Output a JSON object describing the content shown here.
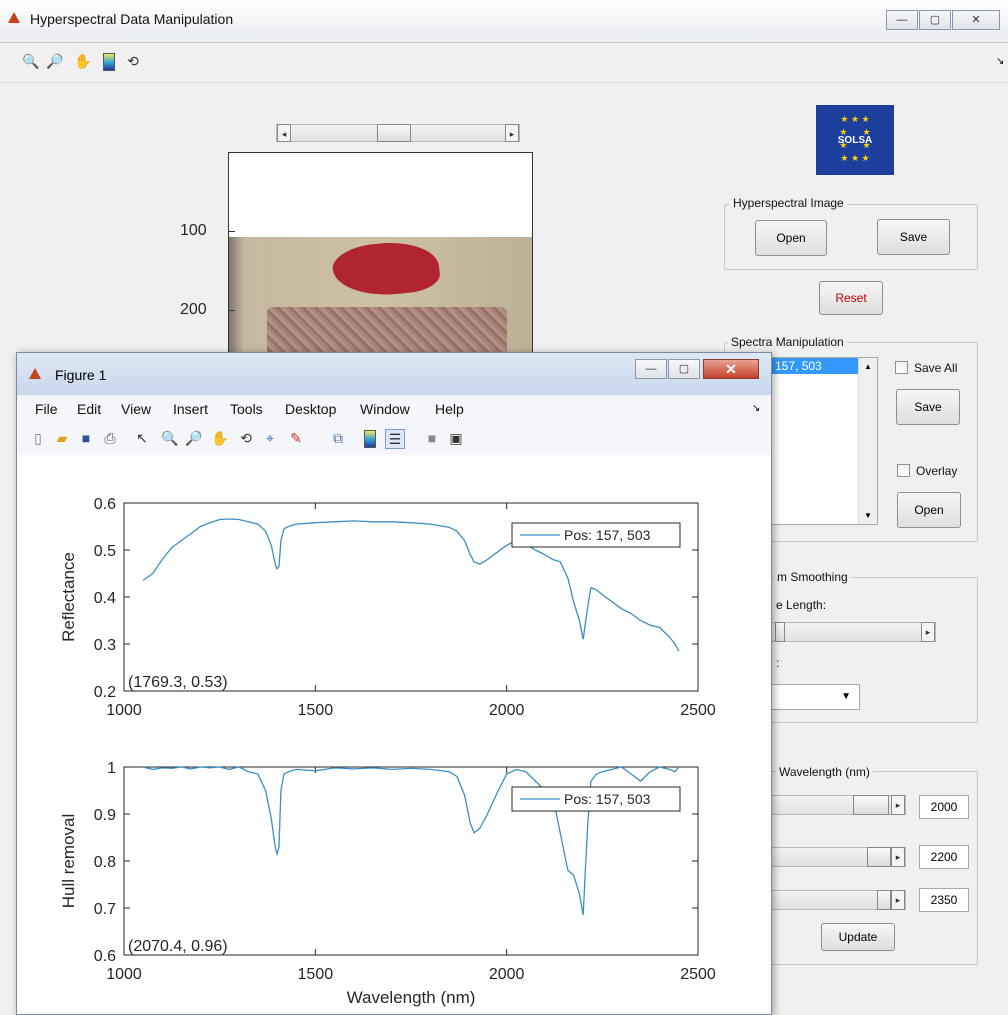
{
  "main_window": {
    "title": "Hyperspectral Data Manipulation",
    "controls": {
      "minimize": "—",
      "maximize": "▢",
      "close": "✕"
    },
    "toolbar_icons": [
      "zoom-in-icon",
      "zoom-out-icon",
      "pan-icon",
      "colorbar-icon",
      "rotate-icon"
    ],
    "image_axis_ticks": [
      "100",
      "200"
    ],
    "logo_text": "SOLSA",
    "hyperspectral_image": {
      "label": "Hyperspectral Image",
      "open": "Open",
      "save": "Save"
    },
    "reset": "Reset",
    "spectra_manipulation": {
      "label": "Spectra Manipulation",
      "list_item": "157, 503",
      "save_all": "Save All",
      "save": "Save",
      "overlay": "Overlay",
      "open": "Open"
    },
    "smoothing": {
      "label": "m Smoothing",
      "sublabel": "e Length:",
      "sublabel2": ":"
    },
    "wavelength": {
      "label": "Wavelength (nm)",
      "values": [
        "2000",
        "2200",
        "2350"
      ],
      "update": "Update"
    }
  },
  "figure_window": {
    "title": "Figure 1",
    "menu": [
      "File",
      "Edit",
      "View",
      "Insert",
      "Tools",
      "Desktop",
      "Window",
      "Help"
    ],
    "toolbar_icons": [
      "new-icon",
      "open-icon",
      "save-icon",
      "print-icon",
      "pointer-icon",
      "zoom-in-icon",
      "zoom-out-icon",
      "pan-icon",
      "rotate-icon",
      "datacursor-icon",
      "brush-icon",
      "link-icon",
      "colorbar-icon",
      "legend-icon",
      "hide-icon",
      "layout-icon"
    ]
  },
  "chart_data": [
    {
      "type": "line",
      "ylabel": "Reflectance",
      "xlabel": "",
      "xlim": [
        1000,
        2500
      ],
      "ylim": [
        0.2,
        0.6
      ],
      "xticks": [
        "1000",
        "1500",
        "2000",
        "2500"
      ],
      "yticks": [
        "0.2",
        "0.3",
        "0.4",
        "0.5",
        "0.6"
      ],
      "legend": "Pos: 157, 503",
      "legend_position": "top-right",
      "annotation": "(1769.3, 0.53)",
      "color": "#3b8fc6",
      "series": [
        {
          "name": "Pos: 157, 503",
          "x": [
            1050,
            1075,
            1100,
            1125,
            1150,
            1175,
            1200,
            1225,
            1250,
            1275,
            1300,
            1325,
            1350,
            1370,
            1385,
            1395,
            1400,
            1405,
            1410,
            1418,
            1430,
            1450,
            1500,
            1550,
            1600,
            1650,
            1700,
            1750,
            1800,
            1850,
            1870,
            1890,
            1905,
            1915,
            1930,
            1950,
            1975,
            2000,
            2025,
            2050,
            2075,
            2100,
            2120,
            2140,
            2160,
            2175,
            2190,
            2200,
            2205,
            2212,
            2220,
            2235,
            2250,
            2275,
            2300,
            2325,
            2350,
            2375,
            2400,
            2425,
            2440,
            2450
          ],
          "y": [
            0.435,
            0.45,
            0.48,
            0.505,
            0.52,
            0.535,
            0.55,
            0.558,
            0.565,
            0.566,
            0.565,
            0.56,
            0.555,
            0.54,
            0.51,
            0.47,
            0.46,
            0.465,
            0.52,
            0.545,
            0.55,
            0.555,
            0.558,
            0.56,
            0.562,
            0.56,
            0.56,
            0.558,
            0.555,
            0.548,
            0.54,
            0.52,
            0.49,
            0.475,
            0.47,
            0.48,
            0.495,
            0.51,
            0.52,
            0.512,
            0.5,
            0.49,
            0.48,
            0.475,
            0.44,
            0.39,
            0.35,
            0.31,
            0.34,
            0.38,
            0.42,
            0.415,
            0.405,
            0.39,
            0.375,
            0.365,
            0.35,
            0.34,
            0.335,
            0.315,
            0.3,
            0.285
          ]
        }
      ]
    },
    {
      "type": "line",
      "ylabel": "Hull removal",
      "xlabel": "Wavelength (nm)",
      "xlim": [
        1000,
        2500
      ],
      "ylim": [
        0.6,
        1
      ],
      "xticks": [
        "1000",
        "1500",
        "2000",
        "2500"
      ],
      "yticks": [
        "0.6",
        "0.7",
        "0.8",
        "0.9",
        "1"
      ],
      "legend": "Pos: 157, 503",
      "legend_position": "top-right",
      "annotation": "(2070.4, 0.96)",
      "color": "#3b8fc6",
      "series": [
        {
          "name": "Pos: 157, 503",
          "x": [
            1050,
            1075,
            1100,
            1125,
            1150,
            1175,
            1200,
            1225,
            1250,
            1275,
            1300,
            1325,
            1350,
            1370,
            1385,
            1395,
            1400,
            1405,
            1410,
            1418,
            1430,
            1450,
            1500,
            1550,
            1600,
            1650,
            1700,
            1750,
            1800,
            1850,
            1870,
            1890,
            1905,
            1915,
            1930,
            1950,
            1975,
            2000,
            2025,
            2050,
            2075,
            2100,
            2120,
            2140,
            2160,
            2175,
            2190,
            2200,
            2205,
            2212,
            2220,
            2235,
            2250,
            2275,
            2300,
            2325,
            2350,
            2375,
            2400,
            2425,
            2440,
            2450
          ],
          "y": [
            1,
            0.995,
            0.998,
            0.997,
            1,
            0.996,
            1,
            0.998,
            1,
            0.995,
            1,
            0.99,
            0.985,
            0.95,
            0.89,
            0.83,
            0.815,
            0.83,
            0.95,
            0.985,
            0.99,
            0.995,
            0.992,
            0.998,
            0.996,
            0.998,
            0.995,
            0.997,
            0.995,
            0.99,
            0.98,
            0.94,
            0.88,
            0.86,
            0.87,
            0.9,
            0.945,
            0.985,
            0.995,
            0.99,
            0.97,
            0.95,
            0.94,
            0.86,
            0.78,
            0.77,
            0.73,
            0.685,
            0.77,
            0.88,
            0.97,
            0.985,
            0.99,
            0.995,
            1,
            0.985,
            0.97,
            0.99,
            1,
            0.995,
            0.99,
            1
          ]
        }
      ]
    }
  ]
}
